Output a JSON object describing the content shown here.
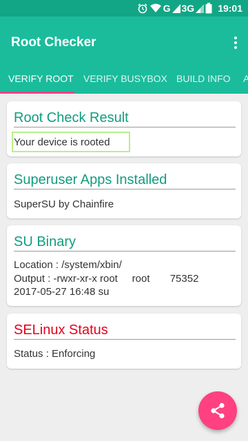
{
  "status_bar": {
    "network": "G",
    "network_secondary": "3G",
    "time": "19:01",
    "icons": [
      "alarm-icon",
      "wifi-icon",
      "signal-icon",
      "signal-icon",
      "battery-icon"
    ]
  },
  "app": {
    "title": "Root Checker"
  },
  "tabs": [
    {
      "label": "VERIFY ROOT",
      "selected": true
    },
    {
      "label": "VERIFY BUSYBOX",
      "selected": false
    },
    {
      "label": "BUILD INFO",
      "selected": false
    },
    {
      "label": "A",
      "selected": false
    }
  ],
  "cards": {
    "root_check": {
      "title": "Root Check Result",
      "result": "Your device is rooted"
    },
    "superuser": {
      "title": "Superuser Apps Installed",
      "text": "SuperSU by Chainfire"
    },
    "su_binary": {
      "title": "SU Binary",
      "location": "Location : /system/xbin/",
      "output": "Output : -rwxr-xr-x root     root       75352",
      "date": "2017-05-27 16:48 su"
    },
    "selinux": {
      "title": "SELinux Status",
      "status": "Status : Enforcing"
    }
  },
  "fab": {
    "icon": "share-icon"
  },
  "colors": {
    "status_bar": "#12a686",
    "primary": "#1abc9c",
    "accent": "#ff4081",
    "card_title": "#129c80",
    "alert_title": "#e3001b",
    "highlight_border": "#b6ef8b"
  }
}
